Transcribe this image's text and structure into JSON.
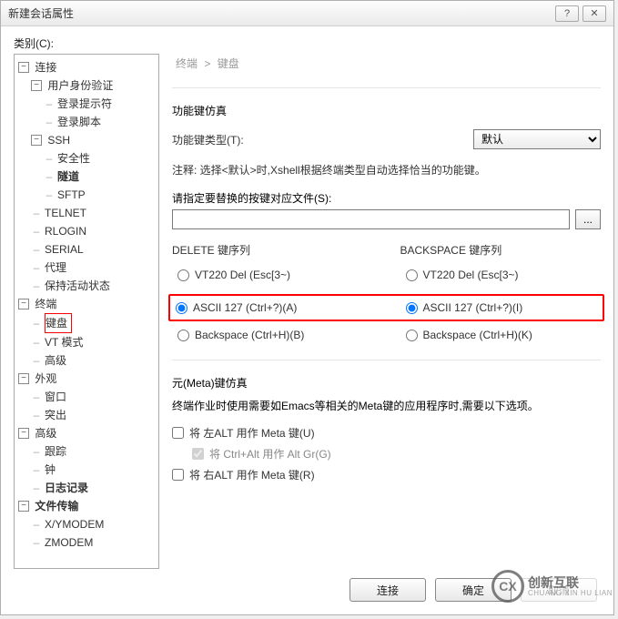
{
  "window": {
    "title": "新建会话属性",
    "help_icon": "?",
    "close_icon": "✕"
  },
  "sidebar": {
    "label": "类别(C):",
    "tree": {
      "connection": {
        "label": "连接",
        "toggle": "−",
        "auth": {
          "label": "用户身份验证",
          "toggle": "−",
          "prompt": "登录提示符",
          "script": "登录脚本"
        },
        "ssh": {
          "label": "SSH",
          "toggle": "−",
          "security": "安全性",
          "tunnel": "隧道",
          "sftp": "SFTP"
        },
        "telnet": "TELNET",
        "rlogin": "RLOGIN",
        "serial": "SERIAL",
        "proxy": "代理",
        "keepalive": "保持活动状态"
      },
      "terminal": {
        "label": "终端",
        "toggle": "−",
        "keyboard": "键盘",
        "vt": "VT 模式",
        "advanced": "高级"
      },
      "appearance": {
        "label": "外观",
        "toggle": "−",
        "window": "窗口",
        "highlight": "突出"
      },
      "advanced": {
        "label": "高级",
        "toggle": "−",
        "trace": "跟踪",
        "bell": "钟",
        "log": "日志记录"
      },
      "transfer": {
        "label": "文件传输",
        "toggle": "−",
        "xymodem": "X/YMODEM",
        "zmodem": "ZMODEM"
      }
    }
  },
  "breadcrumb": {
    "a": "终端",
    "sep": ">",
    "b": "键盘"
  },
  "fn": {
    "title": "功能键仿真",
    "type_label": "功能键类型(T):",
    "type_value": "默认",
    "note": "注释: 选择<默认>时,Xshell根据终端类型自动选择恰当的功能键。"
  },
  "mapfile": {
    "label": "请指定要替换的按键对应文件(S):",
    "browse": "..."
  },
  "delete": {
    "title": "DELETE 键序列",
    "opt1": "VT220 Del (Esc[3~)",
    "opt2": "ASCII 127 (Ctrl+?)(A)",
    "opt3": "Backspace (Ctrl+H)(B)"
  },
  "backspace": {
    "title": "BACKSPACE 键序列",
    "opt1": "VT220 Del (Esc[3~)",
    "opt2": "ASCII 127 (Ctrl+?)(I)",
    "opt3": "Backspace (Ctrl+H)(K)"
  },
  "meta": {
    "title": "元(Meta)键仿真",
    "desc": "终端作业时使用需要如Emacs等相关的Meta键的应用程序时,需要以下选项。",
    "left_alt": "将 左ALT 用作 Meta 键(U)",
    "ctrl_alt": "将 Ctrl+Alt 用作 Alt Gr(G)",
    "right_alt": "将 右ALT 用作 Meta 键(R)"
  },
  "buttons": {
    "connect": "连接",
    "ok": "确定",
    "cancel": "取消"
  },
  "watermark": {
    "brand": "创新互联",
    "sub": "CHUANG XIN HU LIAN",
    "logo": "CX"
  }
}
